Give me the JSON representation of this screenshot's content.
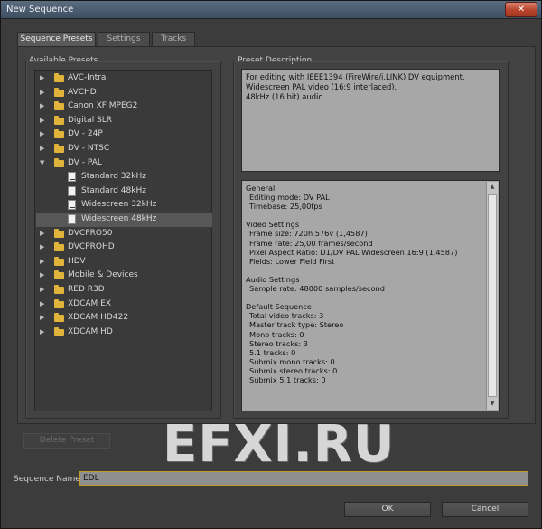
{
  "window": {
    "title": "New Sequence",
    "close_glyph": "✕"
  },
  "tabs": [
    {
      "label": "Sequence Presets",
      "active": true
    },
    {
      "label": "Settings",
      "active": false
    },
    {
      "label": "Tracks",
      "active": false
    }
  ],
  "presets": {
    "heading": "Available Presets",
    "items": [
      {
        "label": "AVC-Intra",
        "type": "folder",
        "expanded": false
      },
      {
        "label": "AVCHD",
        "type": "folder",
        "expanded": false
      },
      {
        "label": "Canon XF MPEG2",
        "type": "folder",
        "expanded": false
      },
      {
        "label": "Digital SLR",
        "type": "folder",
        "expanded": false
      },
      {
        "label": "DV - 24P",
        "type": "folder",
        "expanded": false
      },
      {
        "label": "DV - NTSC",
        "type": "folder",
        "expanded": false
      },
      {
        "label": "DV - PAL",
        "type": "folder",
        "expanded": true
      },
      {
        "label": "Standard 32kHz",
        "type": "preset",
        "selected": false
      },
      {
        "label": "Standard 48kHz",
        "type": "preset",
        "selected": false
      },
      {
        "label": "Widescreen 32kHz",
        "type": "preset",
        "selected": false
      },
      {
        "label": "Widescreen 48kHz",
        "type": "preset",
        "selected": true
      },
      {
        "label": "DVCPRO50",
        "type": "folder",
        "expanded": false
      },
      {
        "label": "DVCPROHD",
        "type": "folder",
        "expanded": false
      },
      {
        "label": "HDV",
        "type": "folder",
        "expanded": false
      },
      {
        "label": "Mobile & Devices",
        "type": "folder",
        "expanded": false
      },
      {
        "label": "RED R3D",
        "type": "folder",
        "expanded": false
      },
      {
        "label": "XDCAM EX",
        "type": "folder",
        "expanded": false
      },
      {
        "label": "XDCAM HD422",
        "type": "folder",
        "expanded": false
      },
      {
        "label": "XDCAM HD",
        "type": "folder",
        "expanded": false
      }
    ]
  },
  "description": {
    "heading": "Preset Description",
    "lines": [
      "For editing with IEEE1394 (FireWire/i.LINK) DV equipment.",
      "Widescreen PAL video (16:9 interlaced).",
      "48kHz (16 bit) audio."
    ]
  },
  "summary": {
    "lines": [
      {
        "text": "General",
        "indent": false
      },
      {
        "text": "Editing mode: DV PAL",
        "indent": true
      },
      {
        "text": "Timebase: 25,00fps",
        "indent": true
      },
      {
        "text": "",
        "indent": false
      },
      {
        "text": "Video Settings",
        "indent": false
      },
      {
        "text": "Frame size: 720h 576v (1,4587)",
        "indent": true
      },
      {
        "text": "Frame rate: 25,00 frames/second",
        "indent": true
      },
      {
        "text": "Pixel Aspect Ratio: D1/DV PAL Widescreen 16:9 (1.4587)",
        "indent": true
      },
      {
        "text": "Fields: Lower Field First",
        "indent": true
      },
      {
        "text": "",
        "indent": false
      },
      {
        "text": "Audio Settings",
        "indent": false
      },
      {
        "text": "Sample rate: 48000 samples/second",
        "indent": true
      },
      {
        "text": "",
        "indent": false
      },
      {
        "text": "Default Sequence",
        "indent": false
      },
      {
        "text": "Total video tracks: 3",
        "indent": true
      },
      {
        "text": "Master track type: Stereo",
        "indent": true
      },
      {
        "text": "Mono tracks: 0",
        "indent": true
      },
      {
        "text": "Stereo tracks: 3",
        "indent": true
      },
      {
        "text": "5.1 tracks: 0",
        "indent": true
      },
      {
        "text": "Submix mono tracks: 0",
        "indent": true
      },
      {
        "text": "Submix stereo tracks: 0",
        "indent": true
      },
      {
        "text": "Submix 5.1 tracks: 0",
        "indent": true
      }
    ]
  },
  "actions": {
    "delete_preset": "Delete Preset",
    "ok": "OK",
    "cancel": "Cancel"
  },
  "sequence_name": {
    "label": "Sequence Name:",
    "value": "EDL"
  },
  "watermark": "EFXI.RU",
  "icons": {
    "collapsed_arrow": "▶",
    "expanded_arrow": "▼",
    "scroll_up": "▲",
    "scroll_down": "▼"
  },
  "colors": {
    "folder": "#e0b33a",
    "input_border": "#c69a2a"
  }
}
